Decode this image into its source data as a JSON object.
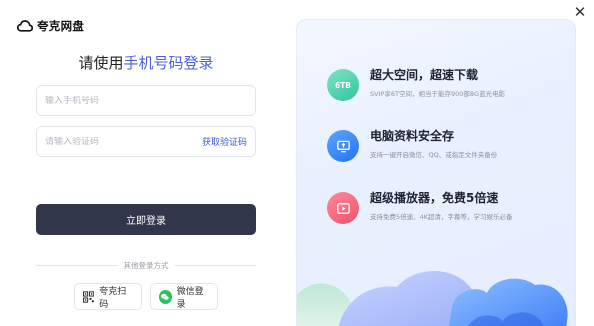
{
  "app": {
    "name": "夸克网盘"
  },
  "login": {
    "title_prefix": "请使用",
    "title_highlight": "手机号码登录",
    "phone_placeholder": "输入手机号码",
    "code_placeholder": "请输入验证码",
    "get_code_label": "获取验证码",
    "submit_label": "立即登录",
    "other_methods_label": "其他登录方式",
    "quark_scan_label": "夸克扫码",
    "wechat_label": "微信登录"
  },
  "promo": {
    "features": [
      {
        "icon_text": "6TB",
        "icon": "storage-icon",
        "title": "超大空间，超速下载",
        "subtitle": "SVIP享6T空间，相当于能存900部8G蓝光电影"
      },
      {
        "icon": "monitor-icon",
        "title": "电脑资料安全存",
        "subtitle": "支持一键开启微信、QQ、或指定文件夹备份"
      },
      {
        "icon": "play-icon",
        "title": "超级播放器，免费5倍速",
        "subtitle": "支持免费5倍速、4K超清，字幕等，学习娱乐必备"
      }
    ]
  },
  "colors": {
    "accent": "#4a5fe0",
    "button": "#32364a",
    "wechat": "#2bc25c"
  }
}
